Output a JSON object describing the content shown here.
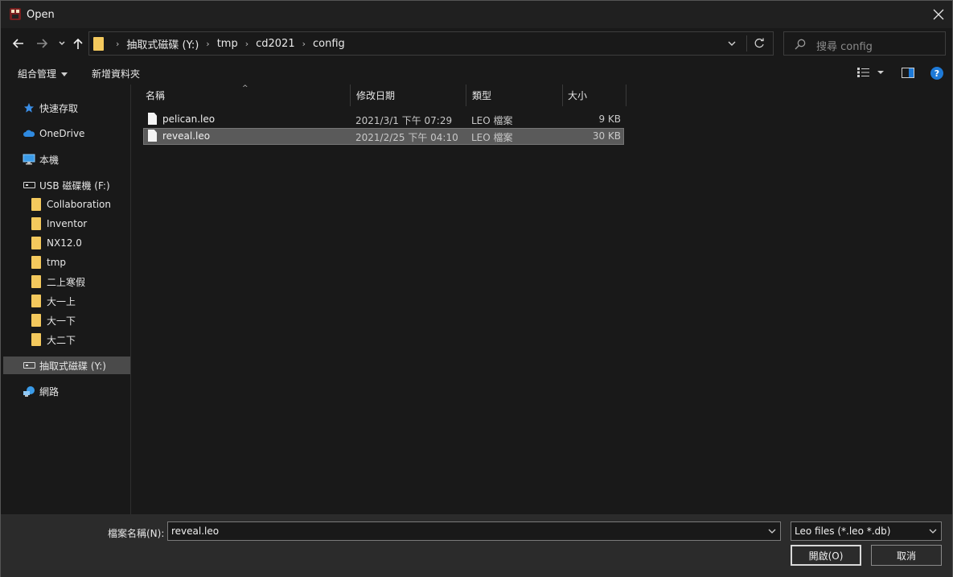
{
  "window": {
    "title": "Open",
    "close_glyph": "✕"
  },
  "nav": {
    "back_icon": "arrow-left-icon",
    "forward_icon": "arrow-right-icon",
    "recent_icon": "chevron-down-icon",
    "up_icon": "arrow-up-icon",
    "breadcrumb": [
      "抽取式磁碟 (Y:)",
      "tmp",
      "cd2021",
      "config"
    ],
    "crumb_separator": "›",
    "search_placeholder": "搜尋 config"
  },
  "toolbar": {
    "organize_label": "組合管理",
    "new_folder_label": "新增資料夾",
    "help_label": "?"
  },
  "sidebar": {
    "items": [
      {
        "label": "快速存取",
        "icon": "star-icon",
        "indent": 0
      },
      {
        "label": "OneDrive",
        "icon": "cloud-icon",
        "indent": 0
      },
      {
        "label": "本機",
        "icon": "computer-icon",
        "indent": 0
      },
      {
        "label": "USB 磁碟機 (F:)",
        "icon": "drive-icon",
        "indent": 0
      },
      {
        "label": "Collaboration",
        "icon": "folder-icon",
        "indent": 1
      },
      {
        "label": "Inventor",
        "icon": "folder-icon",
        "indent": 1
      },
      {
        "label": "NX12.0",
        "icon": "folder-icon",
        "indent": 1
      },
      {
        "label": "tmp",
        "icon": "folder-icon",
        "indent": 1
      },
      {
        "label": "二上寒假",
        "icon": "folder-icon",
        "indent": 1
      },
      {
        "label": "大一上",
        "icon": "folder-icon",
        "indent": 1
      },
      {
        "label": "大一下",
        "icon": "folder-icon",
        "indent": 1
      },
      {
        "label": "大二下",
        "icon": "folder-icon",
        "indent": 1
      },
      {
        "label": "抽取式磁碟 (Y:)",
        "icon": "drive-icon",
        "indent": 0,
        "selected": true
      },
      {
        "label": "網路",
        "icon": "network-icon",
        "indent": 0
      }
    ]
  },
  "filelist": {
    "columns": {
      "name": "名稱",
      "date": "修改日期",
      "type": "類型",
      "size": "大小"
    },
    "sort_indicator": "^",
    "rows": [
      {
        "name": "pelican.leo",
        "date": "2021/3/1 下午 07:29",
        "type": "LEO 檔案",
        "size": "9 KB",
        "selected": false
      },
      {
        "name": "reveal.leo",
        "date": "2021/2/25 下午 04:10",
        "type": "LEO 檔案",
        "size": "30 KB",
        "selected": true
      }
    ]
  },
  "footer": {
    "filename_label": "檔案名稱(N):",
    "filename_value": "reveal.leo",
    "filetype_value": "Leo files (*.leo *.db)",
    "open_label": "開啟(O)",
    "cancel_label": "取消"
  },
  "colors": {
    "background": "#191919",
    "footer": "#2b2b2b",
    "folder": "#f4c95d",
    "selection": "#5a5a5a",
    "accent": "#1e7ad8"
  }
}
